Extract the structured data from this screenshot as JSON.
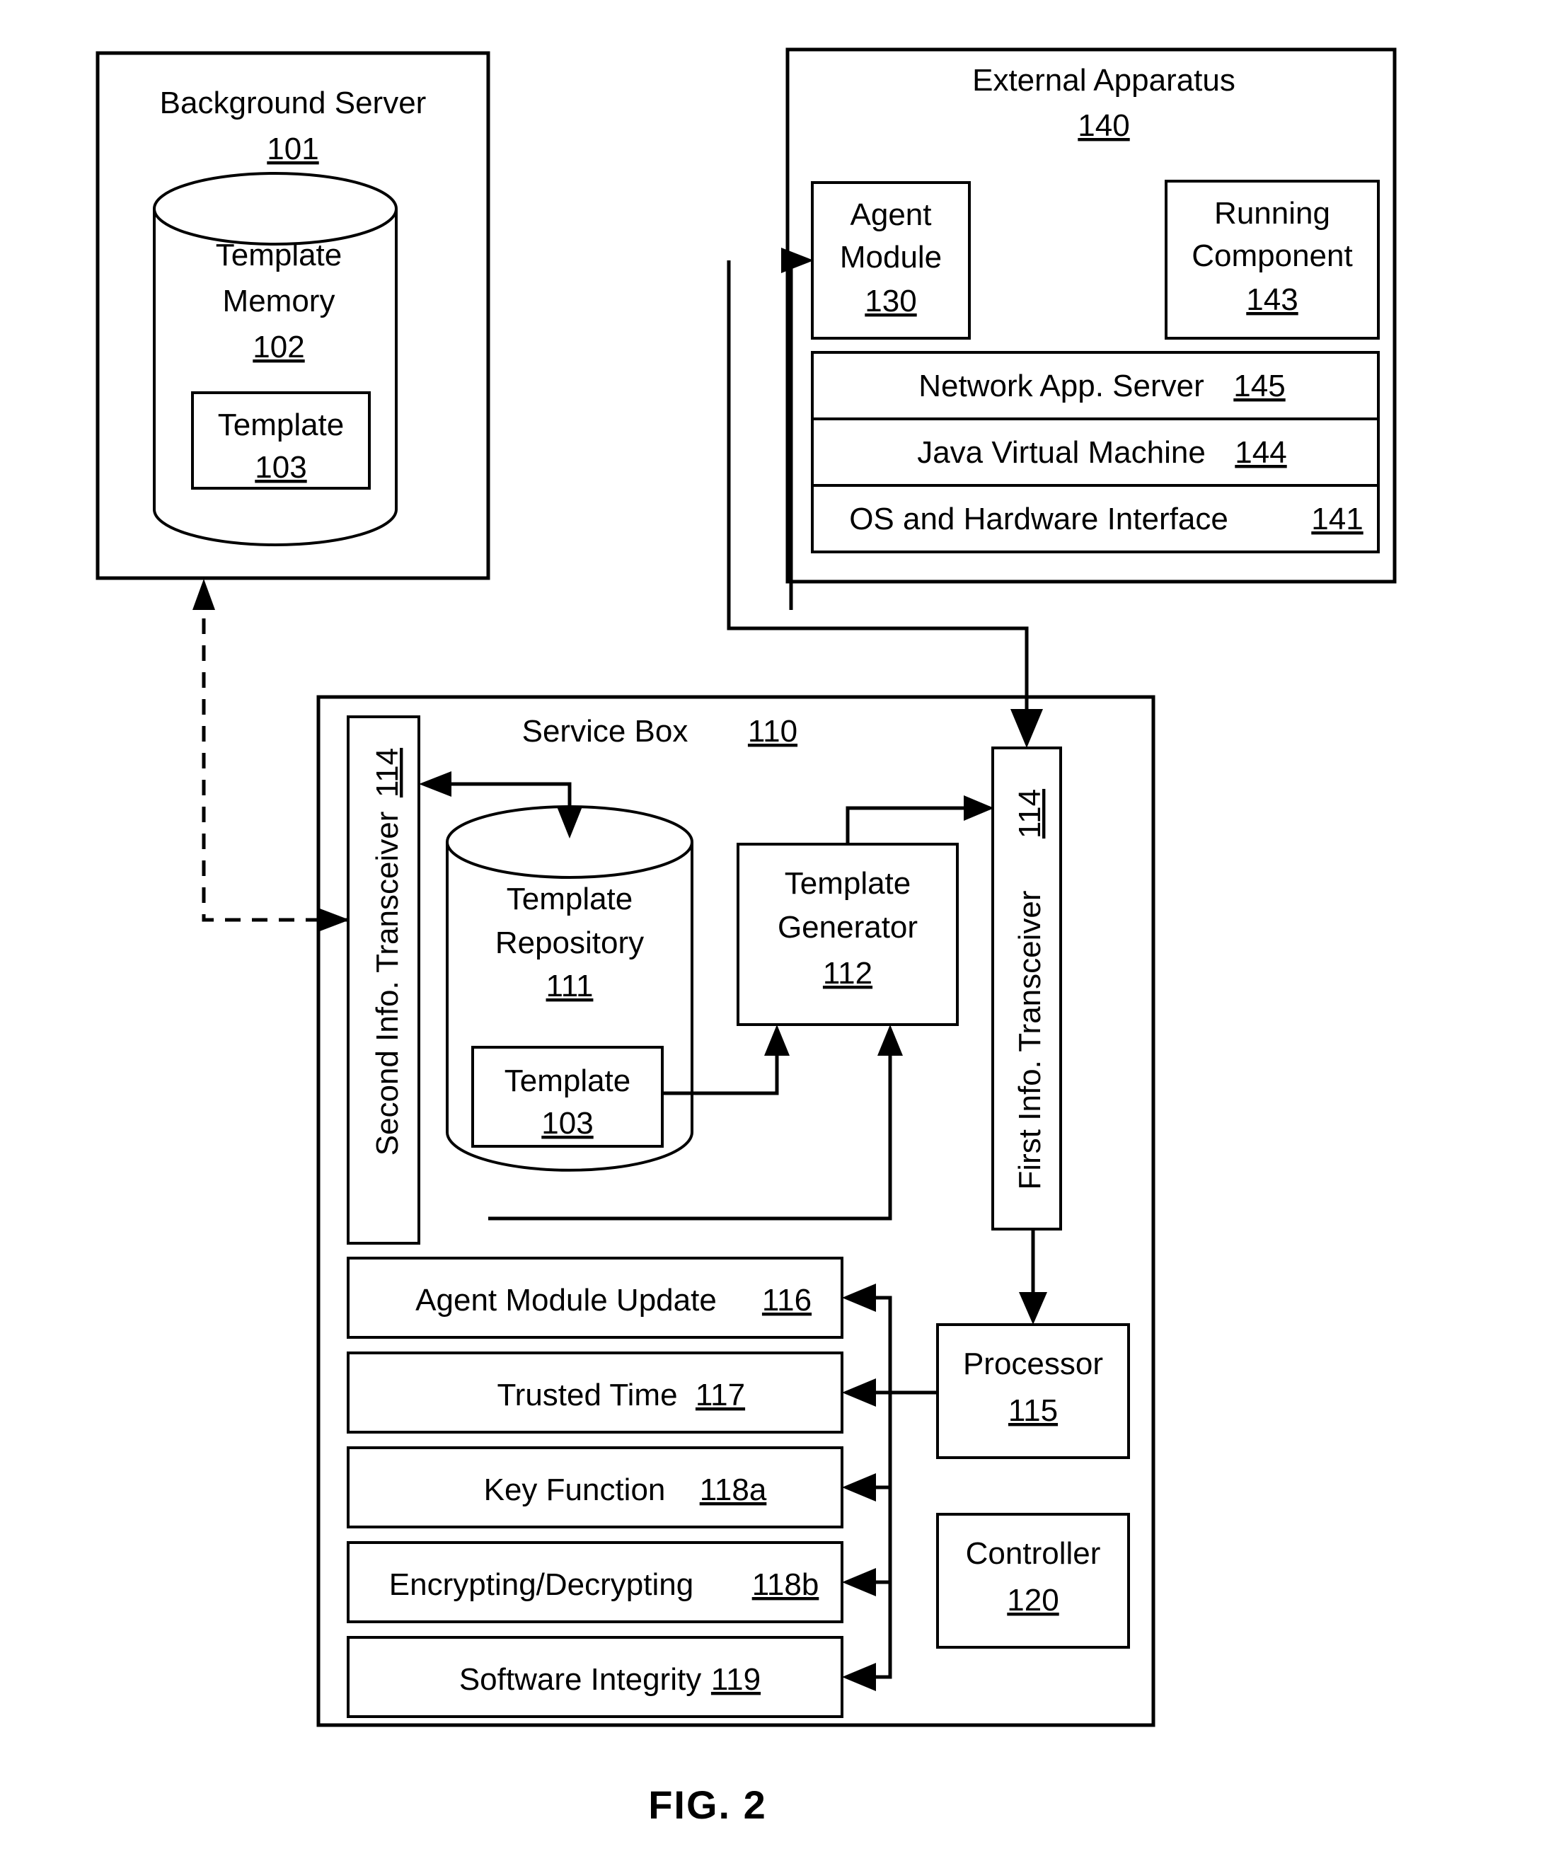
{
  "figure": {
    "caption": "FIG. 2"
  },
  "background_server": {
    "title": "Background Server",
    "ref": "101",
    "template_memory": {
      "line1": "Template",
      "line2": "Memory",
      "ref": "102"
    },
    "template": {
      "label": "Template",
      "ref": "103"
    }
  },
  "external_apparatus": {
    "title": "External Apparatus",
    "ref": "140",
    "agent_module": {
      "line1": "Agent",
      "line2": "Module",
      "ref": "130"
    },
    "running_component": {
      "line1": "Running",
      "line2": "Component",
      "ref": "143"
    },
    "stack": [
      {
        "label": "Network App. Server",
        "ref": "145"
      },
      {
        "label": "Java Virtual Machine",
        "ref": "144"
      },
      {
        "label": "OS and Hardware Interface",
        "ref": "141"
      }
    ]
  },
  "service_box": {
    "title": "Service Box",
    "ref": "110",
    "second_transceiver": {
      "label": "Second Info. Transceiver",
      "ref": "114"
    },
    "first_transceiver": {
      "label": "First Info. Transceiver",
      "ref": "114"
    },
    "template_repository": {
      "line1": "Template",
      "line2": "Repository",
      "ref": "111"
    },
    "template": {
      "label": "Template",
      "ref": "103"
    },
    "template_generator": {
      "line1": "Template",
      "line2": "Generator",
      "ref": "112"
    },
    "processor": {
      "label": "Processor",
      "ref": "115"
    },
    "controller": {
      "label": "Controller",
      "ref": "120"
    },
    "functions": [
      {
        "label": "Agent Module Update",
        "ref": "116"
      },
      {
        "label": "Trusted Time",
        "ref": "117"
      },
      {
        "label": "Key Function",
        "ref": "118a"
      },
      {
        "label": "Encrypting/Decrypting",
        "ref": "118b"
      },
      {
        "label": "Software Integrity",
        "ref": "119"
      }
    ]
  },
  "colors": {
    "stroke": "#000000",
    "background": "#ffffff"
  }
}
